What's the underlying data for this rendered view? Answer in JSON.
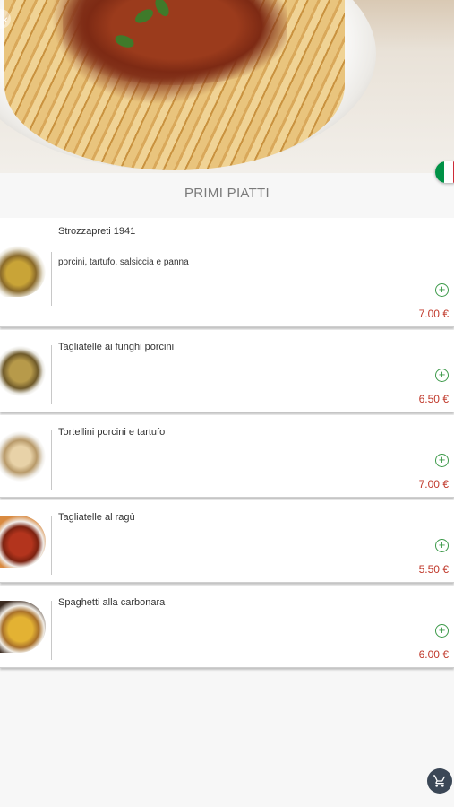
{
  "header": {
    "back_icon": "chevron-left-icon",
    "language_flag": "italian-flag-icon",
    "flag_colors": [
      "#009246",
      "#ffffff",
      "#ce2b37"
    ]
  },
  "section": {
    "title": "PRIMI PIATTI"
  },
  "items": [
    {
      "name": "Strozzapreti 1941",
      "description": "porcini, tartufo, salsiccia e panna",
      "price": "7.00 €",
      "add_icon": "plus-circle-icon"
    },
    {
      "name": "Tagliatelle ai funghi porcini",
      "description": "",
      "price": "6.50 €",
      "add_icon": "plus-circle-icon"
    },
    {
      "name": "Tortellini porcini e tartufo",
      "description": "",
      "price": "7.00 €",
      "add_icon": "plus-circle-icon"
    },
    {
      "name": "Tagliatelle al ragù",
      "description": "",
      "price": "5.50 €",
      "add_icon": "plus-circle-icon"
    },
    {
      "name": "Spaghetti alla carbonara",
      "description": "",
      "price": "6.00 €",
      "add_icon": "plus-circle-icon"
    }
  ],
  "cart": {
    "icon": "shopping-cart-icon",
    "color": "#3b4756"
  },
  "accent": {
    "add_color": "#3d9a4a",
    "price_color": "#c0392b"
  }
}
